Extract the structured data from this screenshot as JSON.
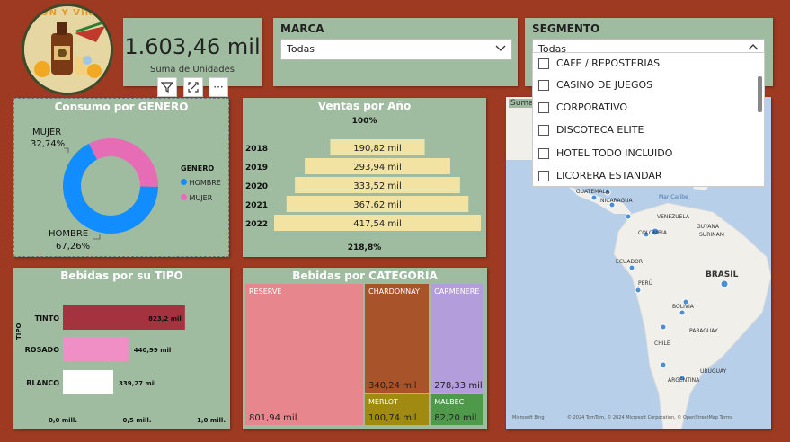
{
  "logo": {
    "text": "RON Y VINO"
  },
  "kpi": {
    "value": "1.603,46 mil",
    "label": "Suma de Unidades"
  },
  "marca": {
    "title": "MARCA",
    "selected": "Todas"
  },
  "segmento": {
    "title": "SEGMENTO",
    "selected": "Todas",
    "options": [
      "CAFE / REPOSTERIAS",
      "CASINO DE JUEGOS",
      "CORPORATIVO",
      "DISCOTECA ELITE",
      "HOTEL TODO INCLUIDO",
      "LICORERA ESTANDAR"
    ]
  },
  "toolbar": {
    "filter_icon": "filter-icon",
    "focus_icon": "focus-mode-icon",
    "more_icon": "more-options-icon",
    "more_label": "···"
  },
  "genero": {
    "title": "Consumo por GENERO",
    "legend_title": "GENERO",
    "legend": [
      "HOMBRE",
      "MUJER"
    ],
    "labels": {
      "mujer_name": "MUJER",
      "mujer_pct": "32,74%",
      "hombre_name": "HOMBRE",
      "hombre_pct": "67,26%"
    }
  },
  "ventas": {
    "title": "Ventas por Año",
    "top_label": "100%",
    "bottom_label": "218,8%"
  },
  "tipo": {
    "title": "Bebidas por su TIPO",
    "axis_label": "TIPO",
    "ticks": [
      "0,0 mill.",
      "0,5 mill.",
      "1,0 mill."
    ]
  },
  "categoria": {
    "title": "Bebidas por CATEGORÍA"
  },
  "map": {
    "title": "Suma de Unidades por País",
    "countries": [
      "GUATEMALA",
      "NICARAGUA",
      "VENEZUELA",
      "GUYANA",
      "COLOMBIA",
      "SURINAM",
      "ECUADOR",
      "PERÚ",
      "BRASIL",
      "BOLIVIA",
      "PARAGUAY",
      "CHILE",
      "URUGUAY",
      "ARGENTINA"
    ],
    "sea_label": "Mar Caribe",
    "attribution": "© 2024 TomTom, © 2024 Microsoft Corporation, © OpenStreetMap Terms",
    "bing": "Microsoft Bing"
  },
  "colors": {
    "background": "#9e3a22",
    "card": "#9fbca0",
    "hombre": "#118dff",
    "mujer": "#e66cb5",
    "funnel": "#f2e3a2",
    "tinto": "#a5333f",
    "rosado": "#ef8fc6",
    "blanco": "#ffffff"
  },
  "chart_data": [
    {
      "type": "pie",
      "title": "Consumo por GENERO",
      "categories": [
        "HOMBRE",
        "MUJER"
      ],
      "values": [
        67.26,
        32.74
      ],
      "unit": "%",
      "legend": "right"
    },
    {
      "type": "bar",
      "subtype": "funnel",
      "title": "Ventas por Año",
      "categories": [
        "2018",
        "2019",
        "2020",
        "2021",
        "2022"
      ],
      "values": [
        190.82,
        293.94,
        333.52,
        367.62,
        417.54
      ],
      "labels": [
        "190,82 mil",
        "293,94 mil",
        "333,52 mil",
        "367,62 mil",
        "417,54 mil"
      ]
    },
    {
      "type": "bar",
      "orientation": "horizontal",
      "title": "Bebidas por su TIPO",
      "categories": [
        "TINTO",
        "ROSADO",
        "BLANCO"
      ],
      "values": [
        823.2,
        440.99,
        339.27
      ],
      "unit": "mil",
      "labels": [
        "823,2 mil",
        "440,99 mil",
        "339,27 mil"
      ],
      "ylabel": "TIPO",
      "xlim": [
        0,
        1000
      ],
      "xticks": [
        "0,0 mill.",
        "0,5 mill.",
        "1,0 mill."
      ]
    },
    {
      "type": "treemap",
      "title": "Bebidas por CATEGORÍA",
      "categories": [
        "RESERVE",
        "CHARDONNAY",
        "CARMENERE",
        "MERLOT",
        "MALBEC"
      ],
      "values": [
        801.94,
        340.24,
        278.33,
        100.74,
        82.2
      ],
      "labels": [
        "801,94 mil",
        "340,24 mil",
        "278,33 mil",
        "100,74 mil",
        "82,20 mil"
      ],
      "colors": [
        "#e8868e",
        "#a9532a",
        "#b39ddb",
        "#a08a10",
        "#4e9a4a"
      ]
    }
  ]
}
